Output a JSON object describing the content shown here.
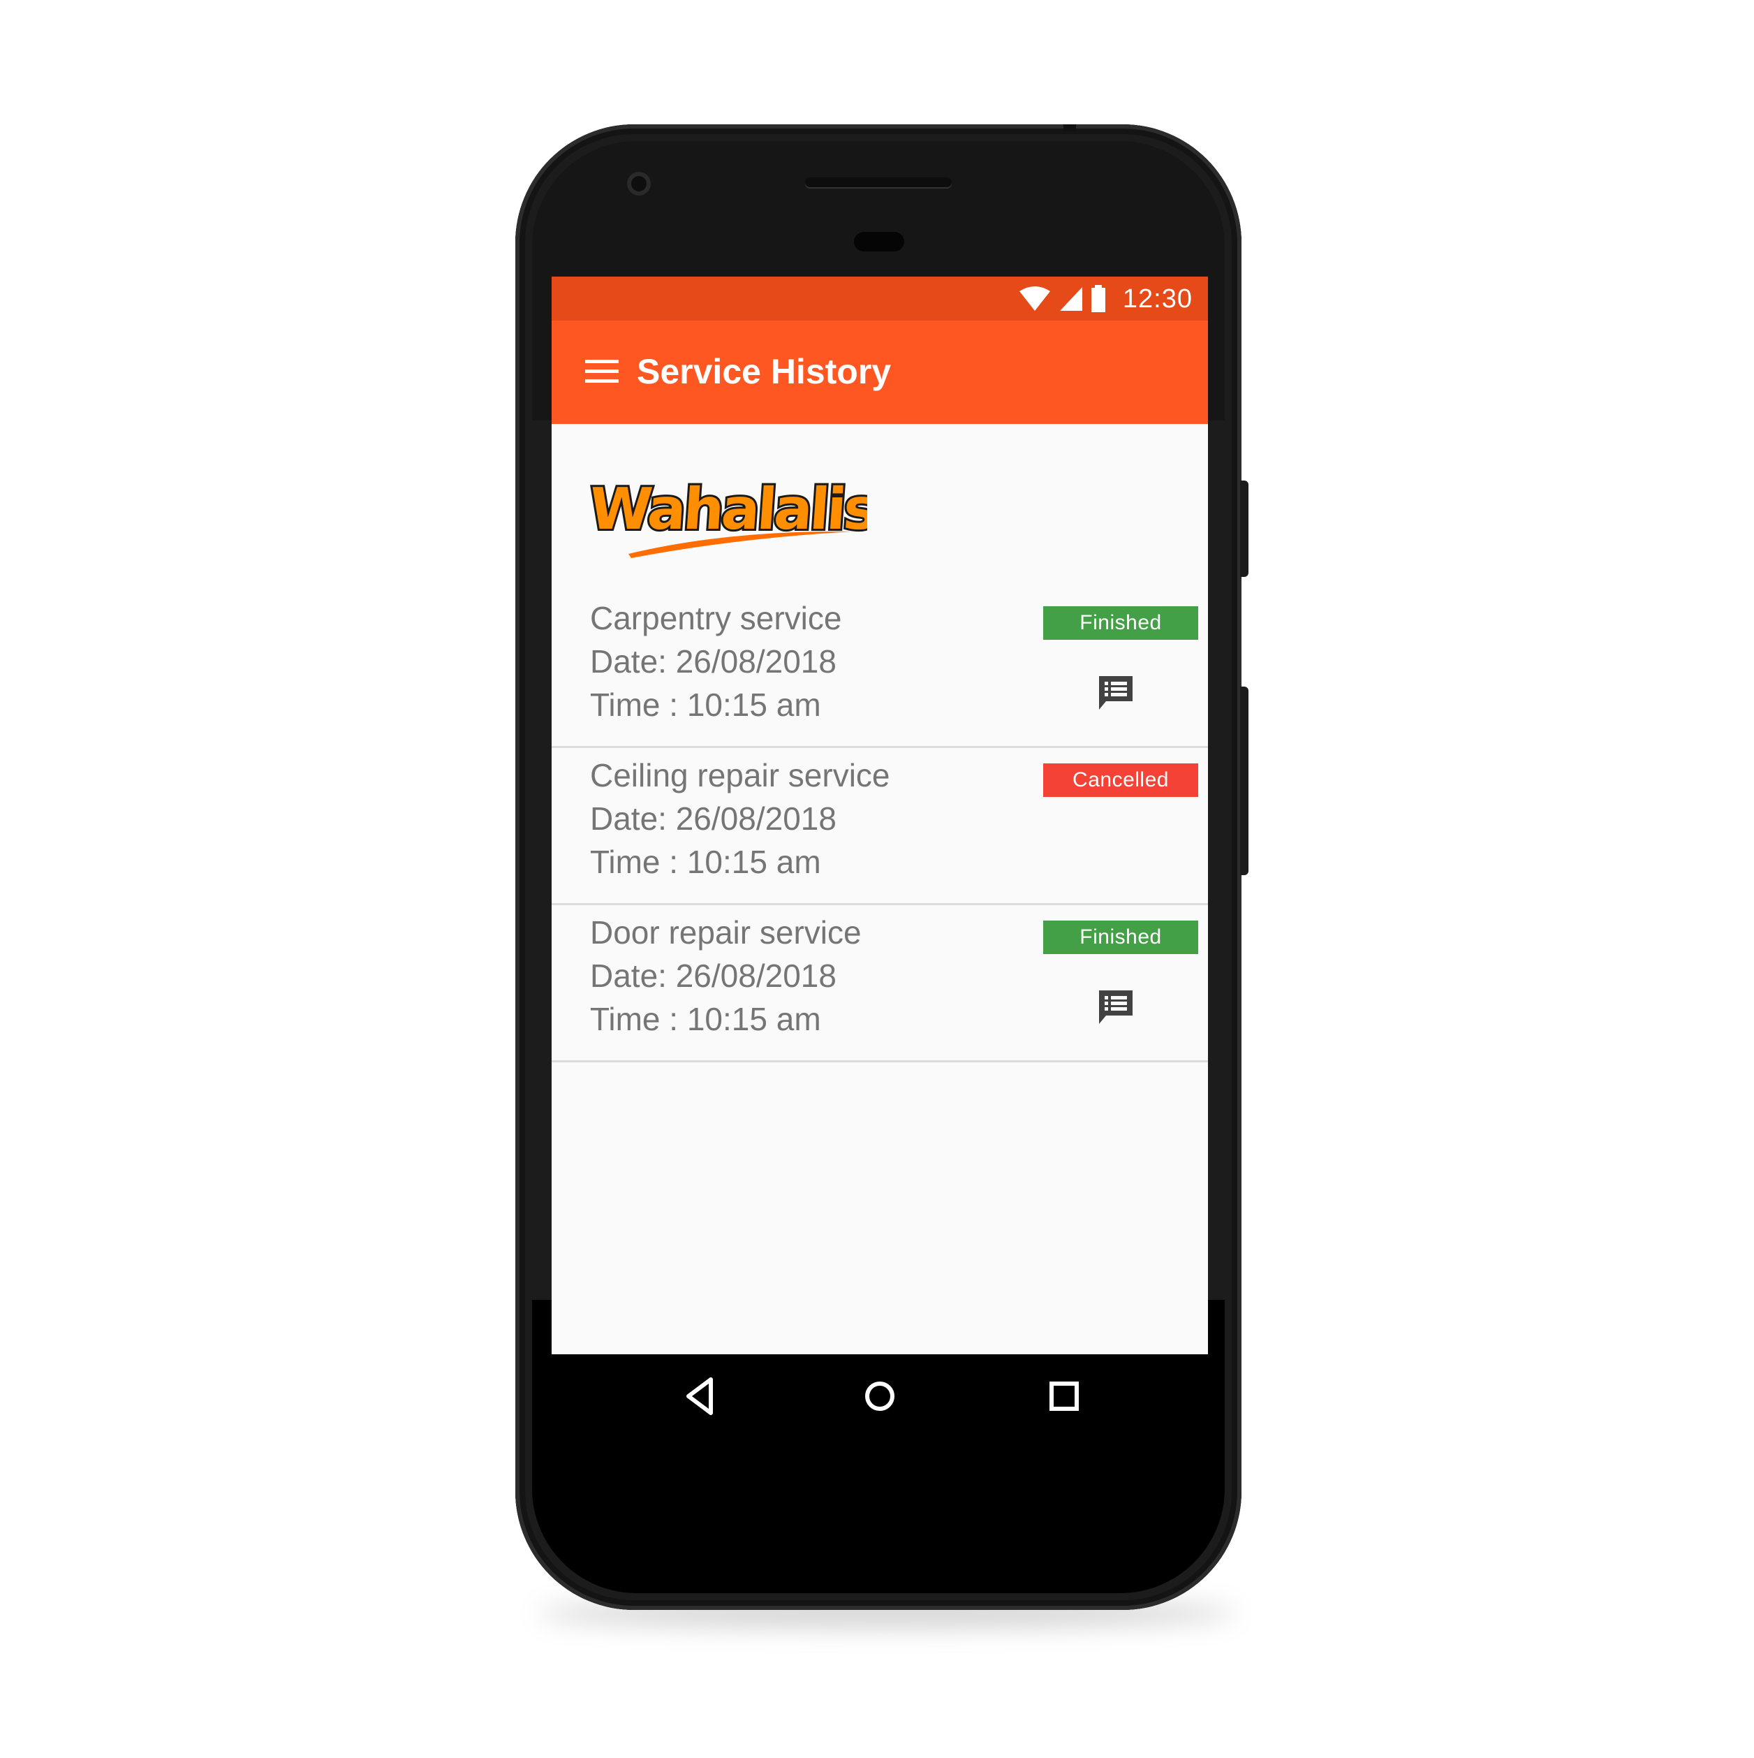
{
  "status_bar": {
    "time": "12:30",
    "icons": [
      "wifi-icon",
      "cell-signal-icon",
      "battery-icon"
    ]
  },
  "app_bar": {
    "title": "Service History",
    "menu_icon": "menu-icon"
  },
  "logo": {
    "text": "Wahalalist"
  },
  "services": [
    {
      "name": "Carpentry service",
      "date": "Date: 26/08/2018",
      "time": "Time : 10:15 am",
      "status": "Finished",
      "status_color": "#43a047",
      "has_review_icon": true
    },
    {
      "name": "Ceiling repair service",
      "date": "Date: 26/08/2018",
      "time": "Time : 10:15 am",
      "status": "Cancelled",
      "status_color": "#f44336",
      "has_review_icon": false
    },
    {
      "name": "Door repair service",
      "date": "Date: 26/08/2018",
      "time": "Time : 10:15 am",
      "status": "Finished",
      "status_color": "#43a047",
      "has_review_icon": true
    }
  ],
  "nav_bar": {
    "buttons": [
      "back-icon",
      "home-icon",
      "recents-icon"
    ]
  },
  "colors": {
    "status_bar": "#e64a19",
    "app_bar": "#ff5722",
    "finished": "#43a047",
    "cancelled": "#f44336",
    "text": "#757575"
  }
}
